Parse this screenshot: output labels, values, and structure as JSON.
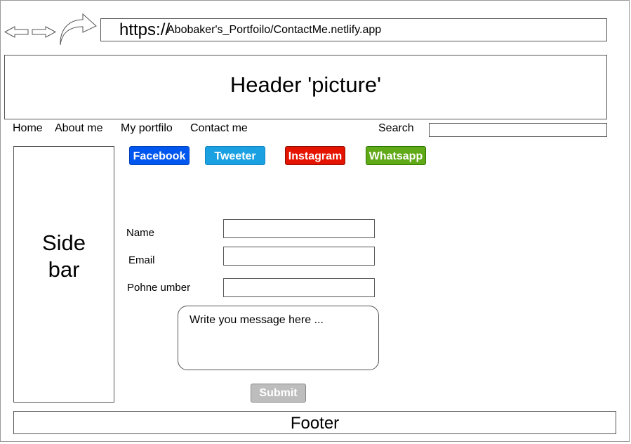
{
  "browser": {
    "url_protocol": "https://",
    "url_path": "Abobaker's_Portfoilo/ContactMe.netlify.app",
    "icons": [
      "back-arrow-icon",
      "forward-arrow-icon",
      "refresh-arrow-icon"
    ]
  },
  "header": {
    "title": "Header 'picture'"
  },
  "nav": {
    "items": [
      {
        "label": "Home"
      },
      {
        "label": "About me"
      },
      {
        "label": "My portfilo"
      },
      {
        "label": "Contact me"
      }
    ],
    "search_label": "Search"
  },
  "sidebar": {
    "label_line1": "Side",
    "label_line2": "bar"
  },
  "social": {
    "buttons": [
      {
        "label": "Facebook",
        "color": "#0057ef"
      },
      {
        "label": "Tweeter",
        "color": "#1ba1e2"
      },
      {
        "label": "Instagram",
        "color": "#e51400"
      },
      {
        "label": "Whatsapp",
        "color": "#60a917"
      }
    ]
  },
  "form": {
    "name_label": "Name",
    "email_label": "Email",
    "phone_label": "Pohne umber",
    "message_placeholder": "Write you message here ...",
    "submit_label": "Submit"
  },
  "footer": {
    "label": "Footer"
  }
}
